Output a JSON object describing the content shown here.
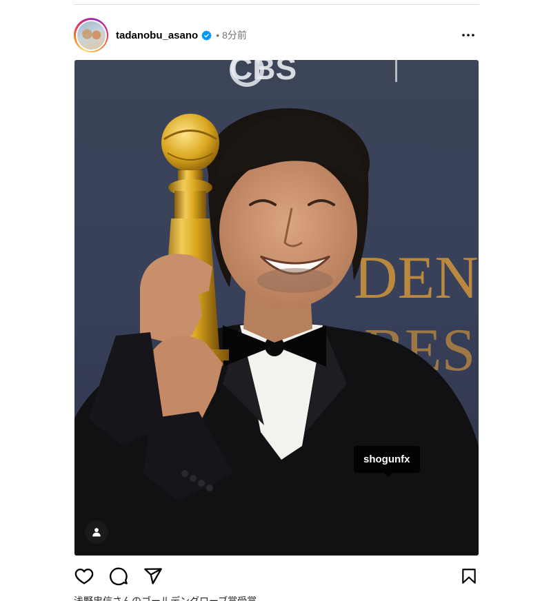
{
  "post": {
    "username": "tadanobu_asano",
    "separator": "•",
    "time_ago": "8分前",
    "verified": true,
    "photo_tag": "shogunfx",
    "photo_backdrop_text": [
      "CBS",
      "DEN",
      "BES"
    ],
    "caption_partial": "浅野忠信さんのゴールデングローブ賞受賞"
  },
  "icons": {
    "more": "more-horizontal-icon",
    "like": "heart-icon",
    "comment": "comment-icon",
    "share": "share-icon",
    "save": "bookmark-icon",
    "user_tag": "user-tag-icon",
    "verified": "verified-badge-icon"
  },
  "colors": {
    "verified_blue": "#0095f6",
    "muted_text": "#737373",
    "divider": "#dbdbdb",
    "trophy_gold": "#d9a61e"
  }
}
